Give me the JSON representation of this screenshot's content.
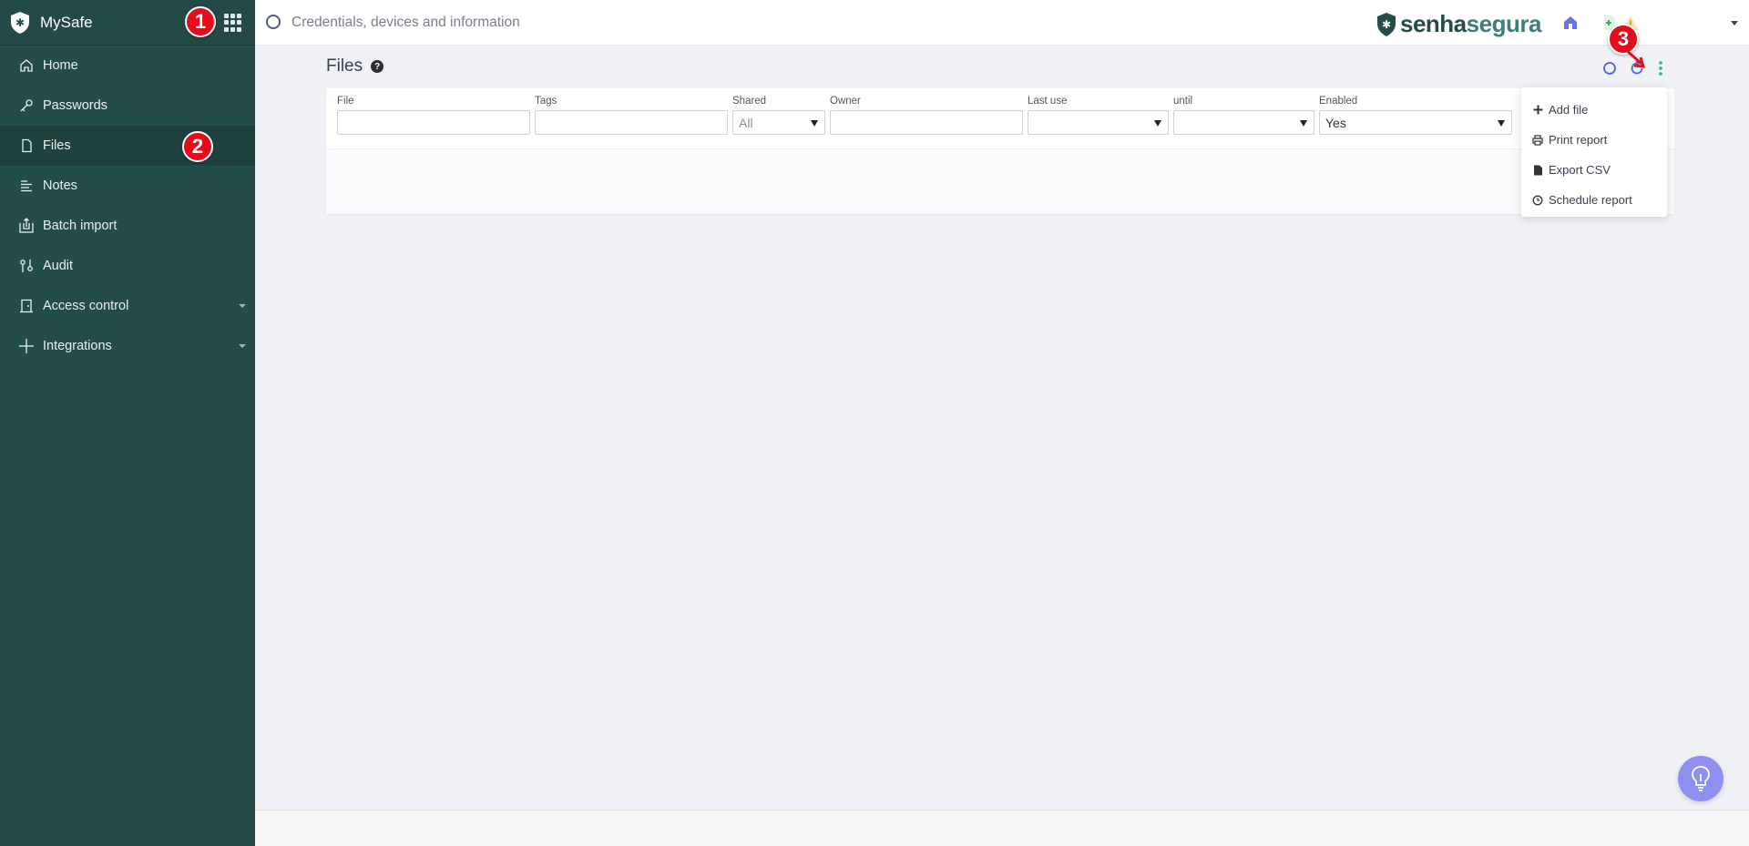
{
  "app": {
    "name": "MySafe"
  },
  "sidebar": {
    "items": [
      {
        "label": "Home",
        "icon": "home-icon"
      },
      {
        "label": "Passwords",
        "icon": "key-icon"
      },
      {
        "label": "Files",
        "icon": "file-icon",
        "active": true
      },
      {
        "label": "Notes",
        "icon": "notes-icon"
      },
      {
        "label": "Batch import",
        "icon": "import-icon"
      },
      {
        "label": "Audit",
        "icon": "audit-icon"
      },
      {
        "label": "Access control",
        "icon": "door-icon",
        "expandable": true
      },
      {
        "label": "Integrations",
        "icon": "plus-icon",
        "expandable": true
      }
    ]
  },
  "badges": {
    "one": "1",
    "two": "2",
    "three": "3"
  },
  "search": {
    "placeholder": "Credentials, devices and information"
  },
  "logo": {
    "part1": "senha",
    "part2": "segura"
  },
  "page": {
    "title": "Files",
    "help": "?"
  },
  "filters": {
    "file": {
      "label": "File",
      "value": ""
    },
    "tags": {
      "label": "Tags",
      "value": ""
    },
    "shared": {
      "label": "Shared",
      "value": "All"
    },
    "owner": {
      "label": "Owner",
      "value": ""
    },
    "last_use": {
      "label": "Last use",
      "value": ""
    },
    "until": {
      "label": "until",
      "value": ""
    },
    "enabled": {
      "label": "Enabled",
      "value": "Yes"
    }
  },
  "menu": {
    "add_file": "Add file",
    "print_report": "Print report",
    "export_csv": "Export CSV",
    "schedule_report": "Schedule report"
  },
  "colors": {
    "sidebar": "#244d4a",
    "accent": "#4f63d2",
    "badge": "#e40d1b",
    "bulb": "#8e90f0"
  }
}
